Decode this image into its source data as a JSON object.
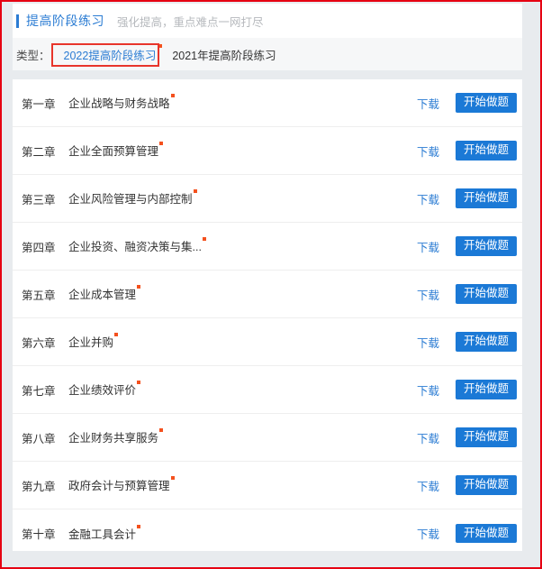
{
  "header": {
    "title": "提高阶段练习",
    "subtitle": "强化提高，重点难点一网打尽",
    "accent_color": "#2b7cd3"
  },
  "filter": {
    "label": "类型：",
    "tabs": [
      {
        "label": "2022提高阶段练习",
        "active": true,
        "badge": true
      },
      {
        "label": "2021年提高阶段练习",
        "active": false,
        "badge": false
      }
    ],
    "highlight_color": "#e8352b"
  },
  "list": {
    "download_label": "下载",
    "start_label": "开始做题",
    "badge_color": "#f4511e",
    "button_color": "#1b79d6",
    "rows": [
      {
        "no": "第一章",
        "title": "企业战略与财务战略",
        "badge": true
      },
      {
        "no": "第二章",
        "title": "企业全面预算管理",
        "badge": true
      },
      {
        "no": "第三章",
        "title": "企业风险管理与内部控制",
        "badge": true
      },
      {
        "no": "第四章",
        "title": "企业投资、融资决策与集...",
        "badge": true
      },
      {
        "no": "第五章",
        "title": "企业成本管理",
        "badge": true
      },
      {
        "no": "第六章",
        "title": "企业并购",
        "badge": true
      },
      {
        "no": "第七章",
        "title": "企业绩效评价",
        "badge": true
      },
      {
        "no": "第八章",
        "title": "企业财务共享服务",
        "badge": true
      },
      {
        "no": "第九章",
        "title": "政府会计与预算管理",
        "badge": true
      },
      {
        "no": "第十章",
        "title": "金融工具会计",
        "badge": true
      }
    ]
  }
}
